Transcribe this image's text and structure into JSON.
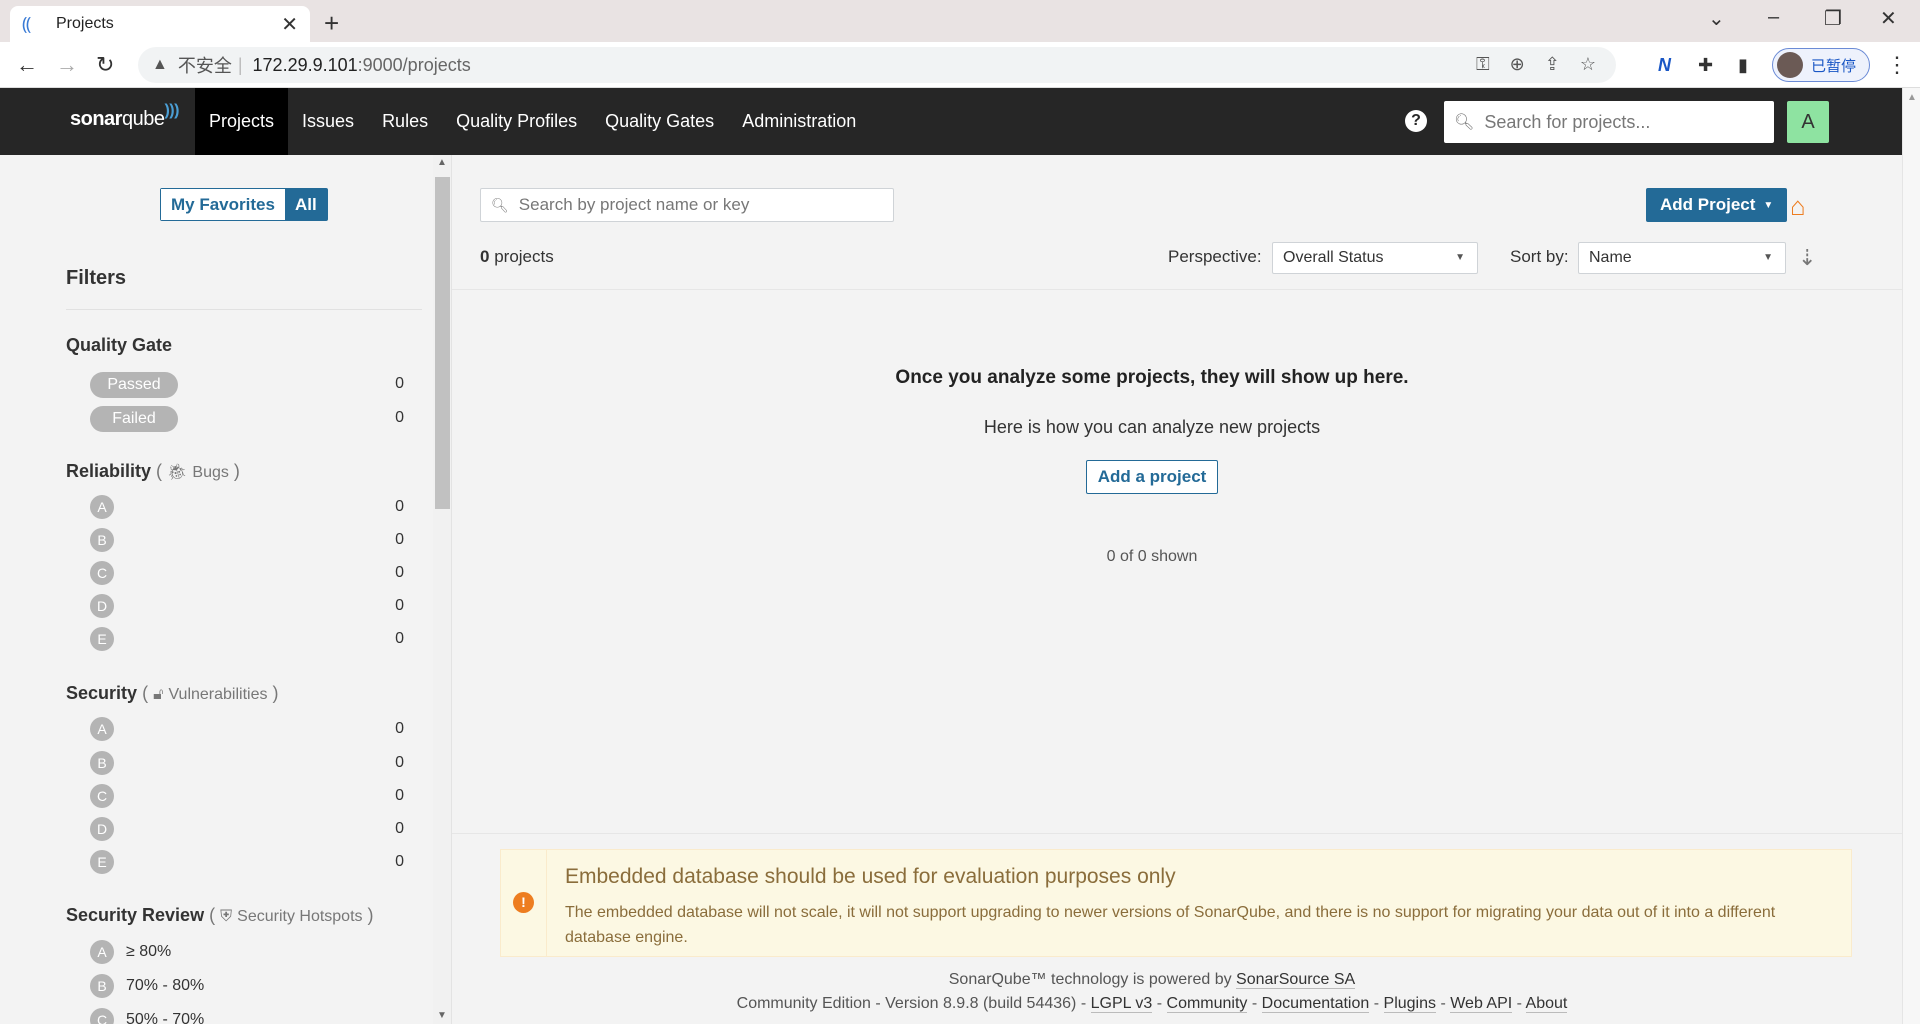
{
  "browser": {
    "tab_title": "Projects",
    "url_warning": "不安全",
    "url_host": "172.29.9.101",
    "url_path": ":9000/projects",
    "profile_label": "已暂停"
  },
  "nav": {
    "logo_text": "sonar",
    "logo_text2": "qube",
    "links": [
      "Projects",
      "Issues",
      "Rules",
      "Quality Profiles",
      "Quality Gates",
      "Administration"
    ],
    "help": "?",
    "search_placeholder": "Search for projects...",
    "avatar_letter": "A"
  },
  "sidebar": {
    "toggle": [
      "My Favorites",
      "All"
    ],
    "filters_title": "Filters",
    "quality_gate": {
      "title": "Quality Gate",
      "items": [
        {
          "label": "Passed",
          "count": "0"
        },
        {
          "label": "Failed",
          "count": "0"
        }
      ]
    },
    "reliability": {
      "title": "Reliability",
      "sub": "Bugs",
      "items": [
        {
          "label": "A",
          "count": "0"
        },
        {
          "label": "B",
          "count": "0"
        },
        {
          "label": "C",
          "count": "0"
        },
        {
          "label": "D",
          "count": "0"
        },
        {
          "label": "E",
          "count": "0"
        }
      ]
    },
    "security": {
      "title": "Security",
      "sub": "Vulnerabilities",
      "items": [
        {
          "label": "A",
          "count": "0"
        },
        {
          "label": "B",
          "count": "0"
        },
        {
          "label": "C",
          "count": "0"
        },
        {
          "label": "D",
          "count": "0"
        },
        {
          "label": "E",
          "count": "0"
        }
      ]
    },
    "security_review": {
      "title": "Security Review",
      "sub": "Security Hotspots",
      "items": [
        {
          "label": "A",
          "range": "≥ 80%"
        },
        {
          "label": "B",
          "range": "70% - 80%"
        },
        {
          "label": "C",
          "range": "50% - 70%"
        }
      ]
    }
  },
  "main": {
    "search_placeholder": "Search by project name or key",
    "add_project": "Add Project",
    "project_count": "0",
    "project_count_label": "projects",
    "perspective_label": "Perspective:",
    "perspective_value": "Overall Status",
    "sort_label": "Sort by:",
    "sort_value": "Name",
    "empty_title": "Once you analyze some projects, they will show up here.",
    "empty_sub": "Here is how you can analyze new projects",
    "add_a_project": "Add a project",
    "shown": "0 of 0 shown"
  },
  "alert": {
    "title": "Embedded database should be used for evaluation purposes only",
    "body": "The embedded database will not scale, it will not support upgrading to newer versions of SonarQube, and there is no support for migrating your data out of it into a different database engine."
  },
  "footer": {
    "powered_prefix": "SonarQube™ technology is powered by",
    "powered_link": "SonarSource SA",
    "edition": "Community Edition - Version 8.9.8 (build 54436) -",
    "links": [
      "LGPL v3",
      "Community",
      "Documentation",
      "Plugins",
      "Web API",
      "About"
    ],
    "sep": "-"
  }
}
